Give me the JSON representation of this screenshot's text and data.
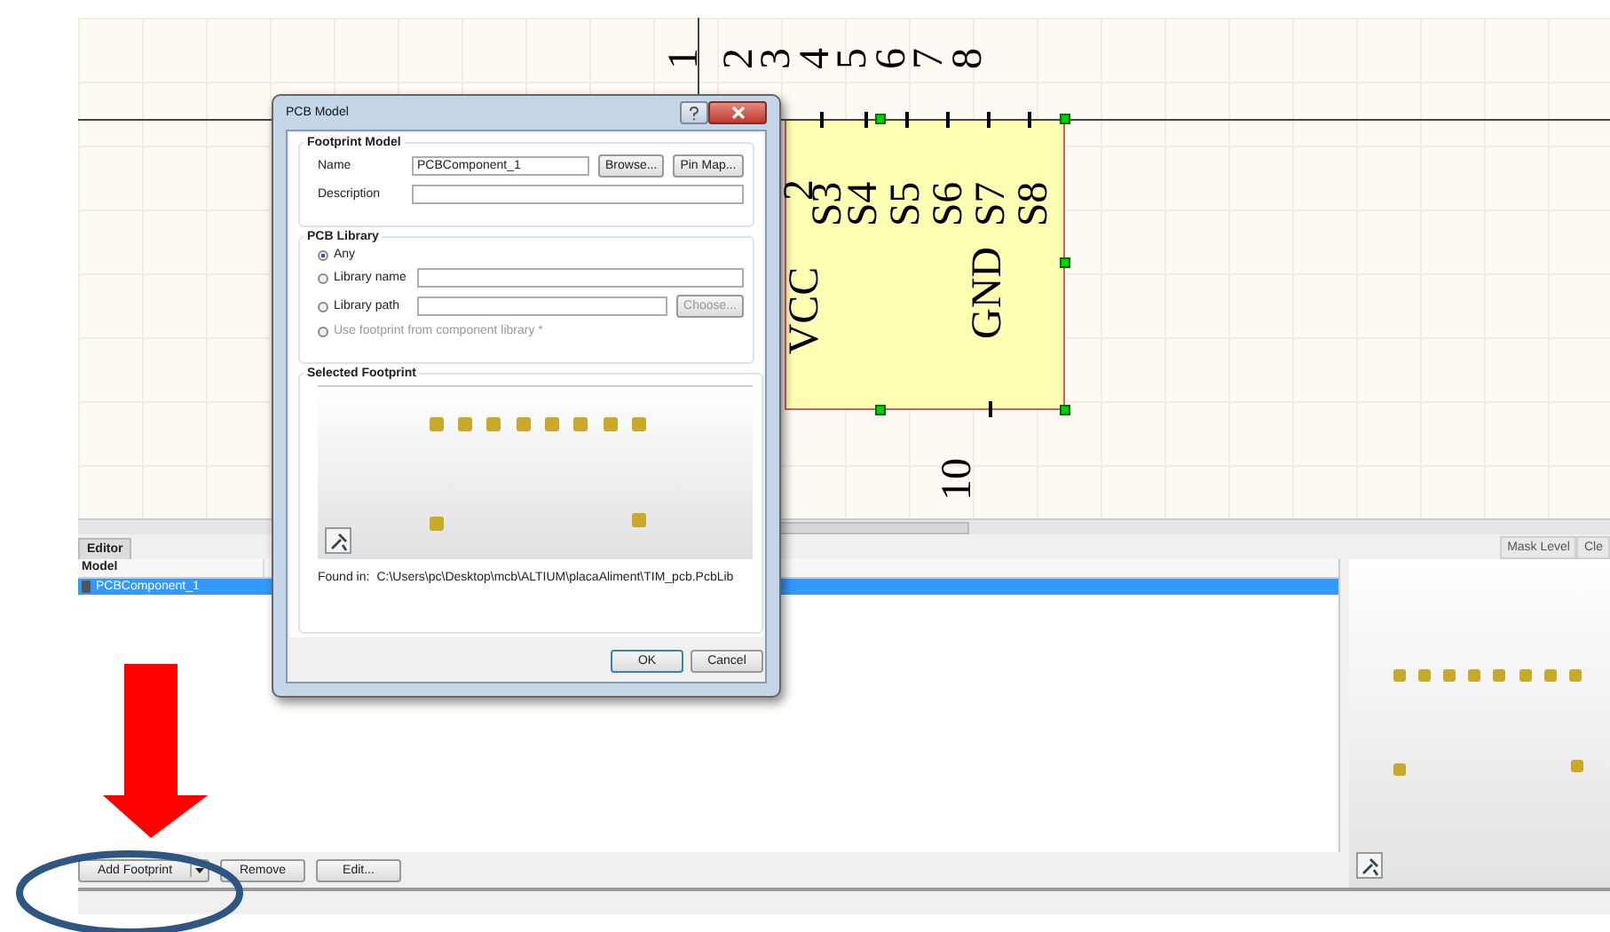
{
  "schematic": {
    "pin_numbers": [
      {
        "text": "1"
      },
      {
        "text": "2"
      },
      {
        "text": "3"
      },
      {
        "text": "4"
      },
      {
        "text": "5"
      },
      {
        "text": "6"
      },
      {
        "text": "7"
      },
      {
        "text": "8"
      }
    ],
    "pin_names": [
      {
        "text": "2"
      },
      {
        "text": "VCC"
      },
      {
        "text": "S3"
      },
      {
        "text": "S4"
      },
      {
        "text": "S5"
      },
      {
        "text": "S6"
      },
      {
        "text": "S7"
      },
      {
        "text": "GND"
      },
      {
        "text": "S8"
      }
    ],
    "bottom_pin_number": "10"
  },
  "panel_tabs": [
    {
      "label": "Editor",
      "selected": true
    }
  ],
  "side_tabs": [
    "Mask Level",
    "Cle"
  ],
  "models": {
    "columns": [
      "Model"
    ],
    "rows": [
      {
        "model": "PCBComponent_1",
        "selected": true
      }
    ]
  },
  "actions": [
    {
      "label": "Add Footprint",
      "kind": "split"
    },
    {
      "label": "Remove",
      "kind": "plain"
    },
    {
      "label": "Edit...",
      "kind": "plain"
    }
  ],
  "dialog": {
    "title": "PCB Model",
    "footprint_model": {
      "title": "Footprint Model",
      "name_label": "Name",
      "name_value": "PCBComponent_1",
      "browse": "Browse...",
      "pin_map": "Pin Map...",
      "description_label": "Description"
    },
    "pcb_library": {
      "title": "PCB Library",
      "options": [
        {
          "label": "Any",
          "selected": true,
          "disabled": false,
          "kind": "plain"
        },
        {
          "label": "Library name",
          "selected": false,
          "disabled": false,
          "kind": "field"
        },
        {
          "label": "Library path",
          "selected": false,
          "disabled": false,
          "kind": "path",
          "button": "Choose...",
          "button_disabled": true
        },
        {
          "label": "Use footprint from component library *",
          "selected": false,
          "disabled": true,
          "kind": "plain"
        }
      ]
    },
    "selected_footprint": {
      "title": "Selected Footprint",
      "found_in_label": "Found in:",
      "found_in_path": "C:\\Users\\pc\\Desktop\\mcb\\ALTIUM\\placaAliment\\TIM_pcb.PcbLib"
    },
    "buttons": [
      {
        "label": "OK",
        "default": true
      },
      {
        "label": "Cancel",
        "default": false
      }
    ]
  }
}
